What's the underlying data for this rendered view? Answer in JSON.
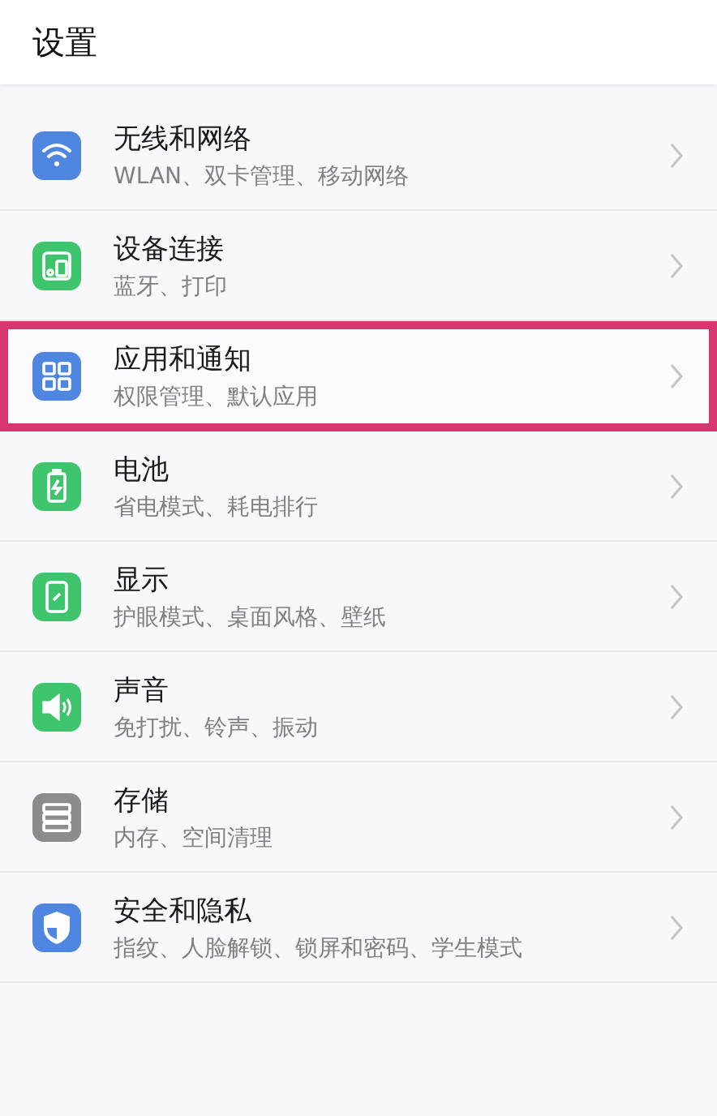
{
  "header": {
    "title": "设置"
  },
  "items": [
    {
      "title": "无线和网络",
      "subtitle": "WLAN、双卡管理、移动网络",
      "kind": "wifi",
      "color": "#4f86e0",
      "highlighted": false
    },
    {
      "title": "设备连接",
      "subtitle": "蓝牙、打印",
      "kind": "devices",
      "color": "#3ec46d",
      "highlighted": false
    },
    {
      "title": "应用和通知",
      "subtitle": "权限管理、默认应用",
      "kind": "apps",
      "color": "#4f86e0",
      "highlighted": true
    },
    {
      "title": "电池",
      "subtitle": "省电模式、耗电排行",
      "kind": "battery",
      "color": "#3ec46d",
      "highlighted": false
    },
    {
      "title": "显示",
      "subtitle": "护眼模式、桌面风格、壁纸",
      "kind": "display",
      "color": "#3ec46d",
      "highlighted": false
    },
    {
      "title": "声音",
      "subtitle": "免打扰、铃声、振动",
      "kind": "sound",
      "color": "#3ec46d",
      "highlighted": false
    },
    {
      "title": "存储",
      "subtitle": "内存、空间清理",
      "kind": "storage",
      "color": "#8c8c8c",
      "highlighted": false
    },
    {
      "title": "安全和隐私",
      "subtitle": "指纹、人脸解锁、锁屏和密码、学生模式",
      "kind": "shield",
      "color": "#4f86e0",
      "highlighted": false
    }
  ]
}
